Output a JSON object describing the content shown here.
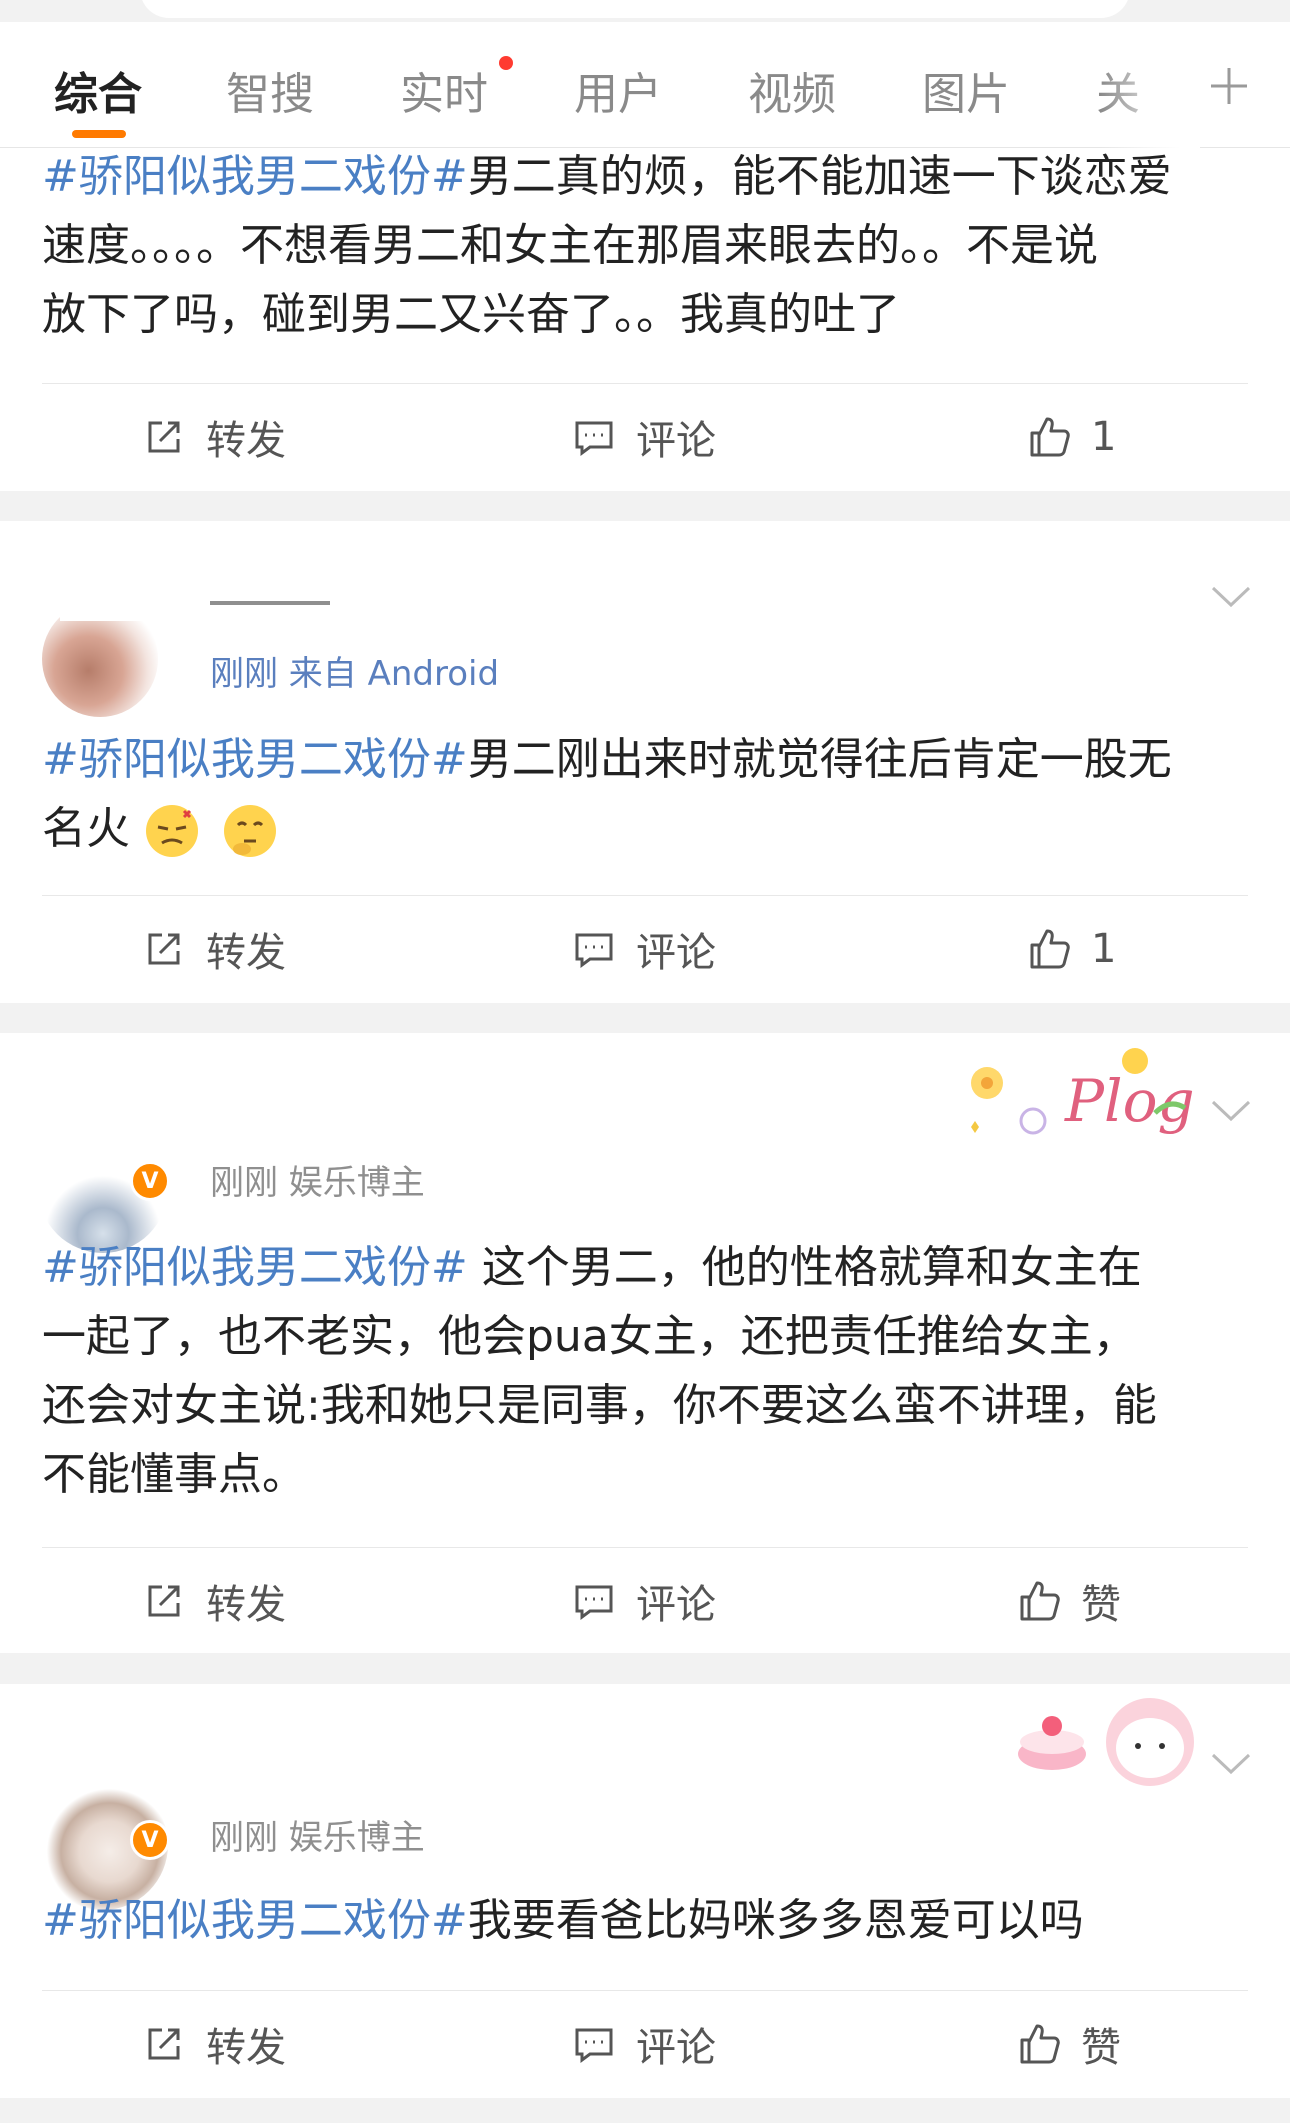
{
  "tabs": {
    "items": [
      "综合",
      "智搜",
      "实时",
      "用户",
      "视频",
      "图片",
      "关"
    ],
    "active_index": 0,
    "realtime_has_dot": true
  },
  "posts": [
    {
      "topic": "#骄阳似我男二戏份#",
      "body_lines": [
        "男二真的烦，能不能加速一下谈恋爱",
        "速度。。。。不想看男二和女主在那眉来眼去的。。不是说",
        "放下了吗，碰到男二又兴奋了。。我真的吐了"
      ],
      "repost_label": "转发",
      "comment_label": "评论",
      "like_label": "1"
    },
    {
      "meta": "刚刚 来自 Android",
      "topic": "#骄阳似我男二戏份#",
      "body_lines": [
        "男二刚出来时就觉得往后肯定一股无",
        "名火"
      ],
      "emojis": [
        "frustrated-emoji",
        "thinking-emoji"
      ],
      "repost_label": "转发",
      "comment_label": "评论",
      "like_label": "1"
    },
    {
      "meta": "刚刚  娱乐博主",
      "badge": "V",
      "sticker_text": "Plog",
      "topic": "#骄阳似我男二戏份#",
      "body_lines": [
        " 这个男二，他的性格就算和女主在",
        "一起了，也不老实，他会pua女主，还把责任推给女主，",
        "还会对女主说:我和她只是同事，你不要这么蛮不讲理，能",
        "不能懂事点。"
      ],
      "repost_label": "转发",
      "comment_label": "评论",
      "like_label": "赞"
    },
    {
      "meta": "刚刚  娱乐博主",
      "badge": "V",
      "topic": "#骄阳似我男二戏份#",
      "body_lines": [
        "我要看爸比妈咪多多恩爱可以吗"
      ],
      "repost_label": "转发",
      "comment_label": "评论",
      "like_label": "赞"
    }
  ],
  "colors": {
    "accent": "#ff7a00",
    "topic": "#4a7fc4",
    "badge": "#ff8a00",
    "dot": "#ff3b30"
  }
}
